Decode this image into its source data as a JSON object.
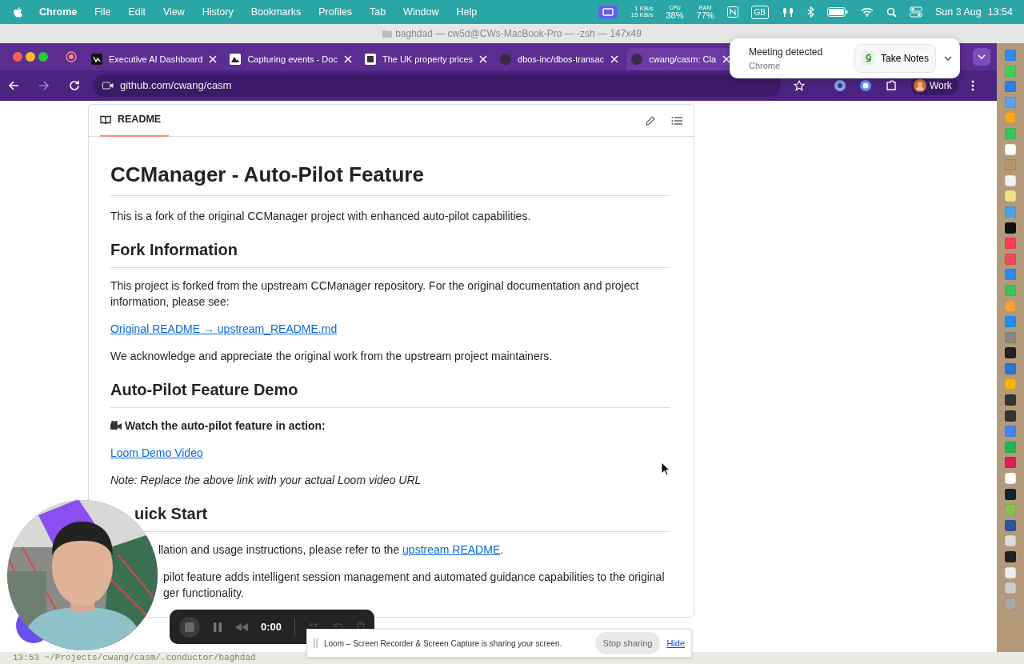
{
  "menu_bar": {
    "app": "Chrome",
    "menus": [
      "File",
      "Edit",
      "View",
      "History",
      "Bookmarks",
      "Profiles",
      "Tab",
      "Window",
      "Help"
    ],
    "status": {
      "net_up": "1 KB/s",
      "net_down": "15 KB/s",
      "cpu_label": "CPU",
      "cpu": "38%",
      "ram_label": "RAM",
      "ram": "77%",
      "keyboard": "GB",
      "date": "Sun 3 Aug",
      "time": "13:54"
    }
  },
  "terminal_title": "baghdad — cw5d@CWs-MacBook-Pro — -zsh — 147x49",
  "tabs": [
    {
      "title": "Executive AI Dashboard",
      "selected": false
    },
    {
      "title": "Capturing events - Doc",
      "selected": false
    },
    {
      "title": "The UK property prices",
      "selected": false
    },
    {
      "title": "dbos-inc/dbos-transac",
      "selected": false
    },
    {
      "title": "cwang/casm: Cla",
      "selected": true
    }
  ],
  "address_bar": {
    "url": "github.com/cwang/casm"
  },
  "profile": "Work",
  "meeting_popup": {
    "title": "Meeting detected",
    "subtitle": "Chrome",
    "button": "Take Notes"
  },
  "readme": {
    "tab": "README",
    "blocks": [
      {
        "kind": "h1",
        "text": "CCManager - Auto-Pilot Feature"
      },
      {
        "kind": "p",
        "text": "This is a fork of the original CCManager project with enhanced auto-pilot capabilities."
      },
      {
        "kind": "h2",
        "text": "Fork Information"
      },
      {
        "kind": "p",
        "text": "This project is forked from the upstream CCManager repository. For the original documentation and project information, please see:"
      },
      {
        "kind": "link",
        "text": "Original README → upstream_README.md"
      },
      {
        "kind": "p",
        "text": "We acknowledge and appreciate the original work from the upstream project maintainers."
      },
      {
        "kind": "h2",
        "text": "Auto-Pilot Feature Demo"
      },
      {
        "kind": "strong",
        "text": "Watch the auto-pilot feature in action:"
      },
      {
        "kind": "link",
        "text": "Loom Demo Video"
      },
      {
        "kind": "note",
        "text": "Note: Replace the above link with your actual Loom video URL"
      },
      {
        "kind": "h2",
        "text": "uick Start",
        "behind_camera": true
      },
      {
        "kind": "p",
        "text": "llation and usage instructions, please refer to the ",
        "link": "upstream README",
        "after": ".",
        "behind_camera": true
      },
      {
        "kind": "lines",
        "lines": [
          "pilot feature adds intelligent session management and automated guidance capabilities to the original",
          "ger functionality."
        ],
        "behind_camera": true
      }
    ]
  },
  "loom_controls": {
    "time": "0:00"
  },
  "sharing_bar": {
    "message": "Loom – Screen Recorder & Screen Capture is sharing your screen.",
    "stop": "Stop sharing",
    "hide": "Hide"
  },
  "terminal_line": "13:53 ~/Projects/cwang/casm/.conductor/baghdad"
}
